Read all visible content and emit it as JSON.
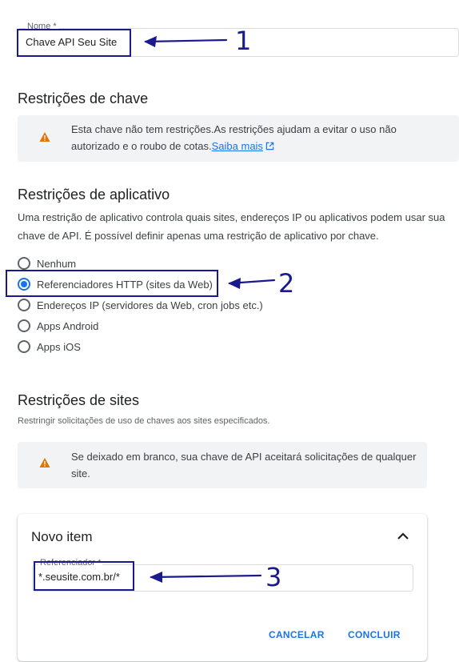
{
  "name_field": {
    "label": "Nome *",
    "value": "Chave API Seu Site"
  },
  "key_restrictions": {
    "title": "Restrições de chave",
    "warning_text": "Esta chave não tem restrições.As restrições ajudam a evitar o uso não autorizado e o roubo de cotas.",
    "link_label": "Saiba mais"
  },
  "app_restrictions": {
    "title": "Restrições de aplicativo",
    "description": "Uma restrição de aplicativo controla quais sites, endereços IP ou aplicativos podem usar sua chave de API. É possível definir apenas uma restrição de aplicativo por chave.",
    "options": [
      {
        "label": "Nenhum",
        "checked": false
      },
      {
        "label": "Referenciadores HTTP (sites da Web)",
        "checked": true
      },
      {
        "label": "Endereços IP (servidores da Web, cron jobs etc.)",
        "checked": false
      },
      {
        "label": "Apps Android",
        "checked": false
      },
      {
        "label": "Apps iOS",
        "checked": false
      }
    ]
  },
  "site_restrictions": {
    "title": "Restrições de sites",
    "subtitle": "Restringir solicitações de uso de chaves aos sites especificados.",
    "warning_text": "Se deixado em branco, sua chave de API aceitará solicitações de qualquer site."
  },
  "new_item": {
    "title": "Novo item",
    "field_label": "Referenciador *",
    "field_value": "*.seusite.com.br/*",
    "cancel_label": "CANCELAR",
    "done_label": "CONCLUIR"
  },
  "annotations": [
    "1",
    "2",
    "3"
  ],
  "colors": {
    "accent": "#1a73e8",
    "warning": "#e37400",
    "annotation": "#1a1a8c"
  },
  "icons": {
    "warning": "warning-triangle-icon",
    "external_link": "open-in-new-icon",
    "collapse": "chevron-up-icon"
  }
}
